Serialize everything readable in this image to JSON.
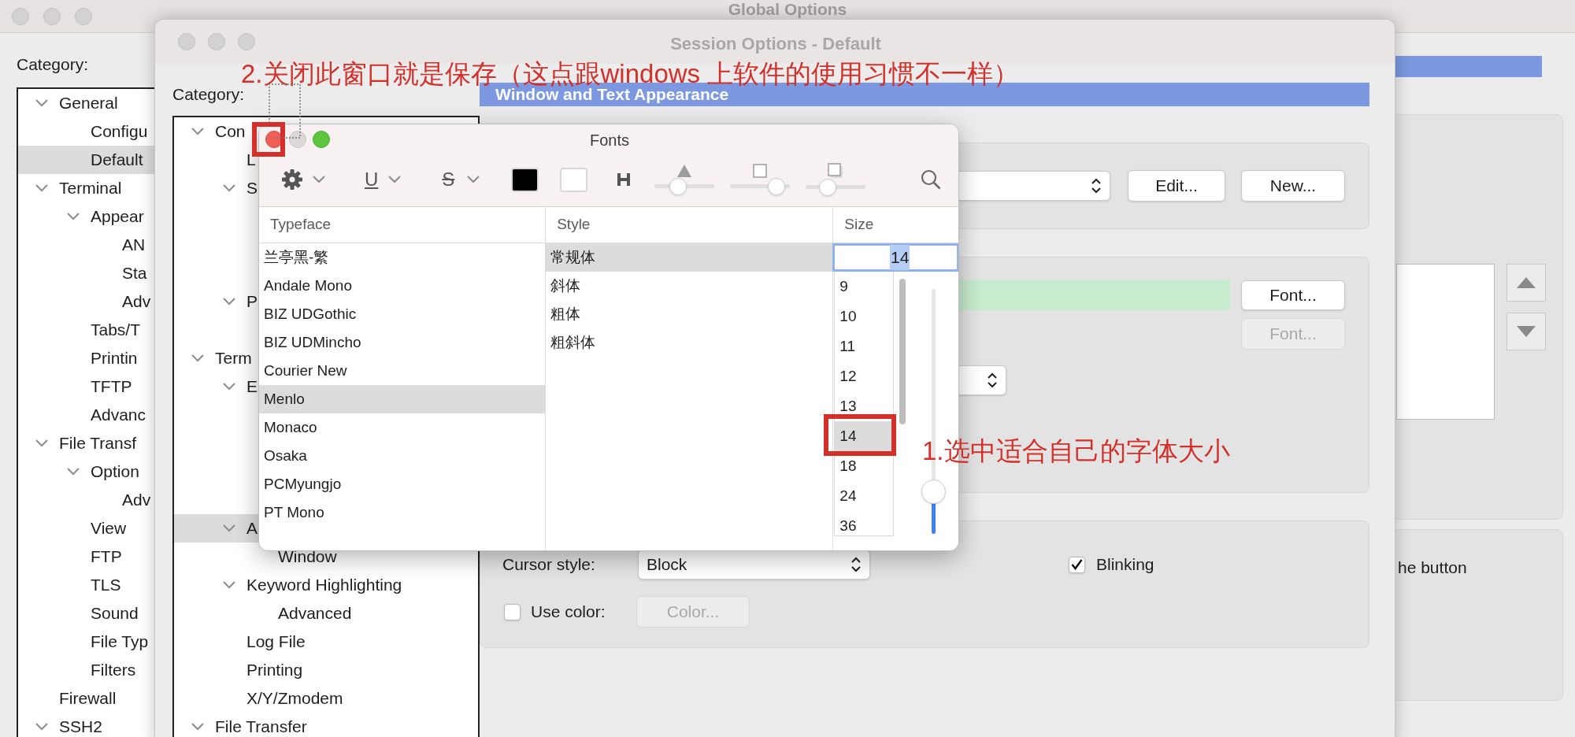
{
  "global_window": {
    "title": "Global Options",
    "category_label": "Category:",
    "tree": [
      {
        "label": "General",
        "expanded": true,
        "selected": false,
        "children": [
          {
            "label": "Configu",
            "selected": false
          },
          {
            "label": "Default",
            "selected": true
          }
        ]
      },
      {
        "label": "Terminal",
        "expanded": true,
        "selected": false,
        "children": [
          {
            "label": "Appear",
            "expanded": true,
            "selected": false,
            "children": [
              {
                "label": "AN",
                "selected": false
              },
              {
                "label": "Sta",
                "selected": false
              },
              {
                "label": "Adv",
                "selected": false
              }
            ]
          },
          {
            "label": "Tabs/T",
            "selected": false
          },
          {
            "label": "Printin",
            "selected": false
          },
          {
            "label": "TFTP",
            "selected": false
          },
          {
            "label": "Advanc",
            "selected": false
          }
        ]
      },
      {
        "label": "File Transf",
        "expanded": true,
        "selected": false,
        "children": [
          {
            "label": "Option",
            "expanded": true,
            "selected": false,
            "children": [
              {
                "label": "Adv",
                "selected": false
              }
            ]
          },
          {
            "label": "View",
            "selected": false
          },
          {
            "label": "FTP",
            "selected": false
          },
          {
            "label": "TLS",
            "selected": false
          },
          {
            "label": "Sound",
            "selected": false
          },
          {
            "label": "File Typ",
            "selected": false
          },
          {
            "label": "Filters",
            "selected": false
          }
        ]
      },
      {
        "label": "Firewall",
        "selected": false
      },
      {
        "label": "SSH2",
        "expanded": true,
        "selected": false
      }
    ],
    "side_text": "he button"
  },
  "session_window": {
    "title": "Session Options - Default",
    "category_label": "Category:",
    "tree": [
      {
        "label": "Con",
        "expanded": true,
        "selected": false,
        "children": [
          {
            "label": "L",
            "selected": false
          },
          {
            "label": "S",
            "expanded": true,
            "selected": false
          },
          {
            "label": "P",
            "expanded": true,
            "selected": false
          }
        ]
      },
      {
        "label": "Term",
        "expanded": true,
        "selected": false,
        "children": [
          {
            "label": "E",
            "expanded": true,
            "selected": false
          },
          {
            "label": "A",
            "expanded": true,
            "selected": true,
            "children": [
              {
                "label": "Window",
                "selected": false
              }
            ]
          },
          {
            "label": "Keyword Highlighting",
            "expanded": true,
            "selected": false,
            "children": [
              {
                "label": "Advanced",
                "selected": false
              }
            ]
          },
          {
            "label": "Log File",
            "selected": false
          },
          {
            "label": "Printing",
            "selected": false
          },
          {
            "label": "X/Y/Zmodem",
            "selected": false
          }
        ]
      },
      {
        "label": "File Transfer",
        "expanded": true,
        "selected": false
      }
    ],
    "section_title": "Window and Text Appearance",
    "scheme_buttons": [
      {
        "label": "Edit...",
        "disabled": false
      },
      {
        "label": "New...",
        "disabled": false
      }
    ],
    "font_buttons": [
      {
        "label": "Font...",
        "disabled": false
      },
      {
        "label": "Font...",
        "disabled": true
      }
    ],
    "cursor_style_label": "Cursor style:",
    "cursor_style_value": "Block",
    "blinking": {
      "label": "Blinking",
      "checked": true
    },
    "use_color": {
      "label": "Use color:",
      "checked": false
    },
    "color_button": {
      "label": "Color...",
      "disabled": true
    }
  },
  "fonts_panel": {
    "title": "Fonts",
    "underline_label": "U",
    "strikethrough_label": "S",
    "sliders": [
      {
        "level": 0.35
      },
      {
        "level": 0.88
      },
      {
        "level": 0.3
      }
    ],
    "columns": [
      "Typeface",
      "Style",
      "Size"
    ],
    "typefaces": [
      {
        "label": "兰亭黑-繁",
        "selected": false
      },
      {
        "label": "Andale Mono",
        "selected": false
      },
      {
        "label": "BIZ UDGothic",
        "selected": false
      },
      {
        "label": "BIZ UDMincho",
        "selected": false
      },
      {
        "label": "Courier New",
        "selected": false
      },
      {
        "label": "Menlo",
        "selected": true
      },
      {
        "label": "Monaco",
        "selected": false
      },
      {
        "label": "Osaka",
        "selected": false
      },
      {
        "label": "PCMyungjo",
        "selected": false
      },
      {
        "label": "PT Mono",
        "selected": false
      }
    ],
    "styles": [
      {
        "label": "常规体",
        "selected": true
      },
      {
        "label": "斜体",
        "selected": false
      },
      {
        "label": "粗体",
        "selected": false
      },
      {
        "label": "粗斜体",
        "selected": false
      }
    ],
    "size_value": "14",
    "sizes": [
      {
        "label": "9",
        "selected": false
      },
      {
        "label": "10",
        "selected": false
      },
      {
        "label": "11",
        "selected": false
      },
      {
        "label": "12",
        "selected": false
      },
      {
        "label": "13",
        "selected": false
      },
      {
        "label": "14",
        "selected": true
      },
      {
        "label": "18",
        "selected": false
      },
      {
        "label": "24",
        "selected": false
      },
      {
        "label": "36",
        "selected": false
      }
    ],
    "size_slider": {
      "level": 0.17
    }
  },
  "annotations": {
    "close_note": "2.关闭此窗口就是保存（这点跟windows 上软件的使用习惯不一样）",
    "size_note": "1.选中适合自己的字体大小"
  }
}
